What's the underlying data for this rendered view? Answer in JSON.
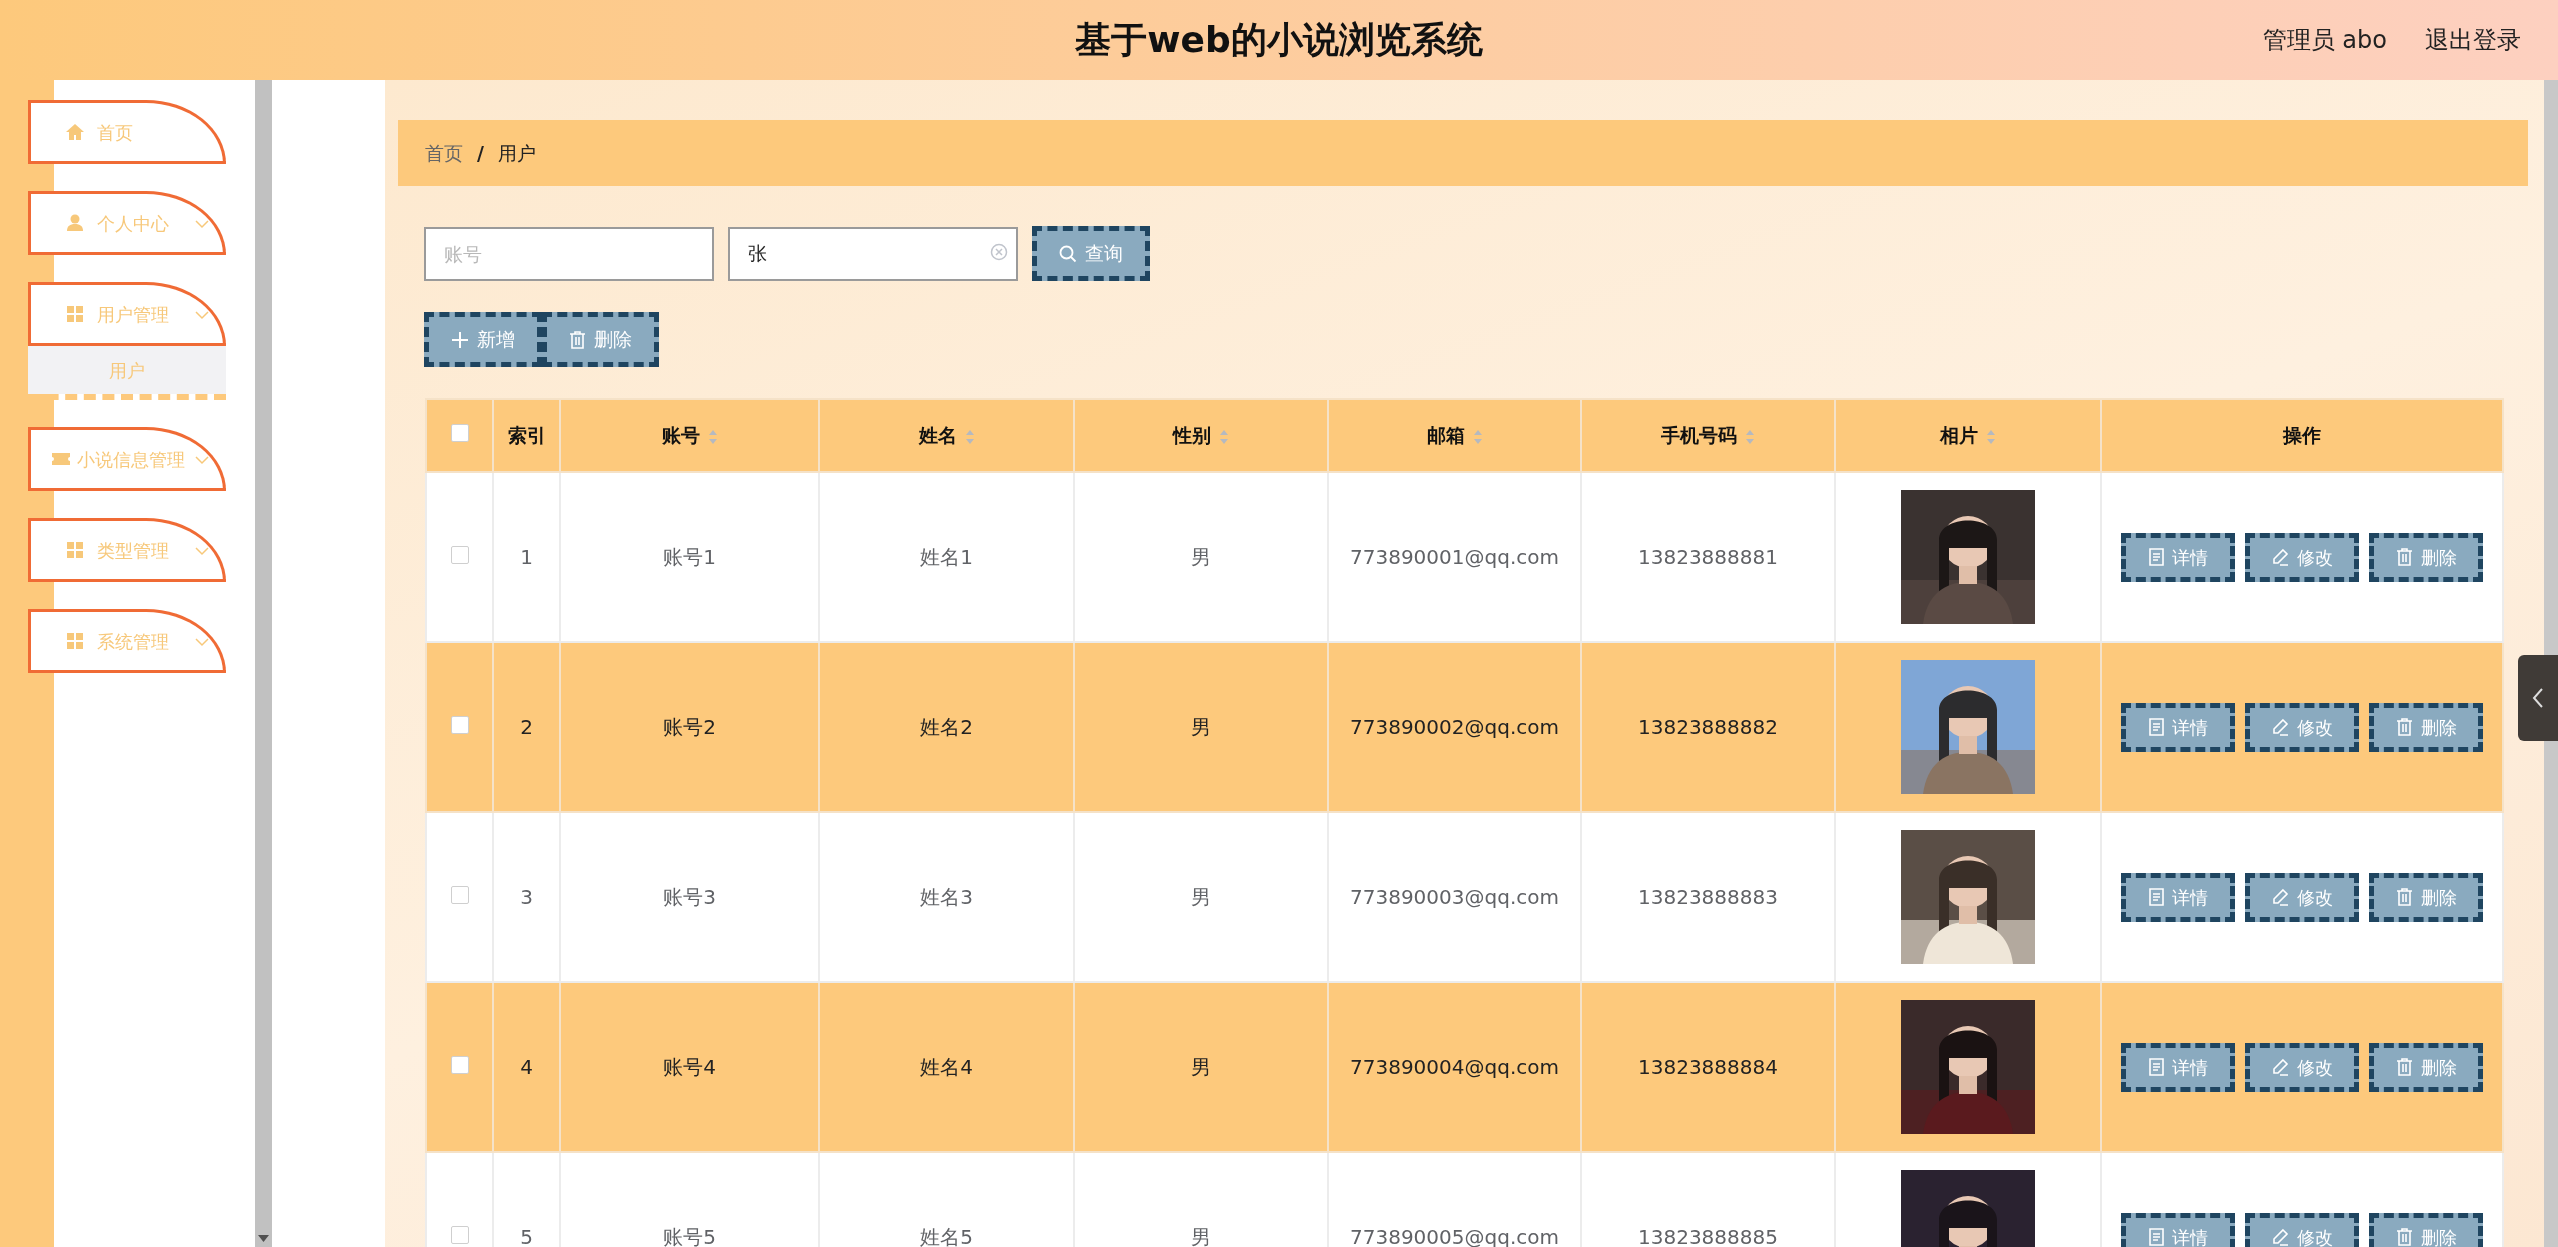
{
  "header": {
    "title": "基于web的小说浏览系统",
    "user": "管理员 abo",
    "logout": "退出登录"
  },
  "sidebar": {
    "items": [
      {
        "label": "首页",
        "kind": "link"
      },
      {
        "label": "个人中心",
        "kind": "menu"
      },
      {
        "label": "用户管理",
        "kind": "menu",
        "children": [
          {
            "label": "用户",
            "selected": true
          }
        ]
      },
      {
        "label": "小说信息管理",
        "kind": "menu"
      },
      {
        "label": "类型管理",
        "kind": "menu"
      },
      {
        "label": "系统管理",
        "kind": "menu"
      }
    ]
  },
  "breadcrumb": {
    "items": [
      "首页",
      "用户"
    ],
    "separator": "/"
  },
  "search": {
    "fields": [
      {
        "placeholder": "账号"
      },
      {
        "value": "张"
      }
    ],
    "button": "查询"
  },
  "toolbar": [
    "新增",
    "删除"
  ],
  "table": {
    "select_all": {
      "checked": false
    },
    "columns": [
      {
        "label": "索引",
        "sortable": false
      },
      {
        "label": "账号",
        "sortable": true
      },
      {
        "label": "姓名",
        "sortable": true
      },
      {
        "label": "性别",
        "sortable": true
      },
      {
        "label": "邮箱",
        "sortable": true
      },
      {
        "label": "手机号码",
        "sortable": true
      },
      {
        "label": "相片",
        "sortable": true
      },
      {
        "label": "操作",
        "sortable": false
      }
    ],
    "rows": [
      {
        "checked": false,
        "cells": [
          "1",
          "账号1",
          "姓名1",
          "男",
          "773890001@qq.com",
          "13823888881"
        ],
        "actions": [
          "详情",
          "修改",
          "删除"
        ]
      },
      {
        "checked": false,
        "cells": [
          "2",
          "账号2",
          "姓名2",
          "男",
          "773890002@qq.com",
          "13823888882"
        ],
        "actions": [
          "详情",
          "修改",
          "删除"
        ]
      },
      {
        "checked": false,
        "cells": [
          "3",
          "账号3",
          "姓名3",
          "男",
          "773890003@qq.com",
          "13823888883"
        ],
        "actions": [
          "详情",
          "修改",
          "删除"
        ]
      },
      {
        "checked": false,
        "cells": [
          "4",
          "账号4",
          "姓名4",
          "男",
          "773890004@qq.com",
          "13823888884"
        ],
        "actions": [
          "详情",
          "修改",
          "删除"
        ]
      },
      {
        "checked": false,
        "cells": [
          "5",
          "账号5",
          "姓名5",
          "男",
          "773890005@qq.com",
          "13823888885"
        ],
        "actions": [
          "详情",
          "修改",
          "删除"
        ]
      }
    ]
  }
}
